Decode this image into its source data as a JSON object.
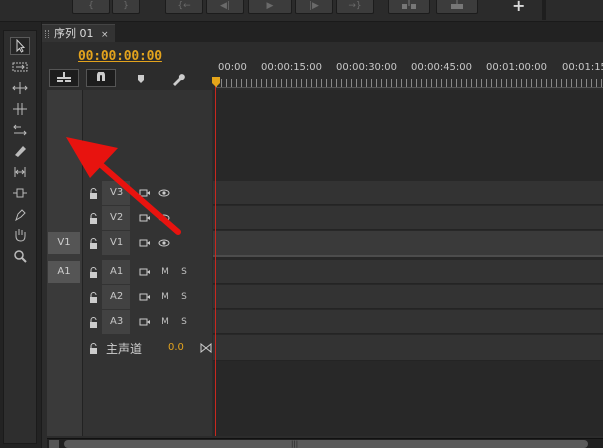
{
  "top_toolbar": {
    "buttons": [
      "{",
      "}",
      "{←",
      "◀|",
      "▶",
      "|▶",
      "→}",
      "",
      ""
    ],
    "add_label": "+"
  },
  "tools": [
    {
      "name": "selection-tool",
      "active": true
    },
    {
      "name": "track-select-tool"
    },
    {
      "name": "ripple-edit-tool"
    },
    {
      "name": "rolling-edit-tool"
    },
    {
      "name": "rate-stretch-tool"
    },
    {
      "name": "razor-tool"
    },
    {
      "name": "slip-tool"
    },
    {
      "name": "slide-tool"
    },
    {
      "name": "pen-tool"
    },
    {
      "name": "hand-tool"
    },
    {
      "name": "zoom-tool"
    }
  ],
  "sequence": {
    "tab_label": "序列 01",
    "tab_close": "×",
    "timecode": "00:00:00:00",
    "ruler_labels": [
      "00:00",
      "00:00:15:00",
      "00:00:30:00",
      "00:00:45:00",
      "00:01:00:00",
      "00:01:15"
    ]
  },
  "video_tracks": [
    {
      "name": "V3",
      "source": ""
    },
    {
      "name": "V2",
      "source": ""
    },
    {
      "name": "V1",
      "source": "V1"
    }
  ],
  "audio_tracks": [
    {
      "name": "A1",
      "source": "A1",
      "m": "M",
      "s": "S"
    },
    {
      "name": "A2",
      "source": "",
      "m": "M",
      "s": "S"
    },
    {
      "name": "A3",
      "source": "",
      "m": "M",
      "s": "S"
    }
  ],
  "master": {
    "name": "主声道",
    "value": "0.0"
  },
  "colors": {
    "timecode": "#e3a31d",
    "playhead": "#c8281f",
    "arrow": "#e8130f"
  }
}
